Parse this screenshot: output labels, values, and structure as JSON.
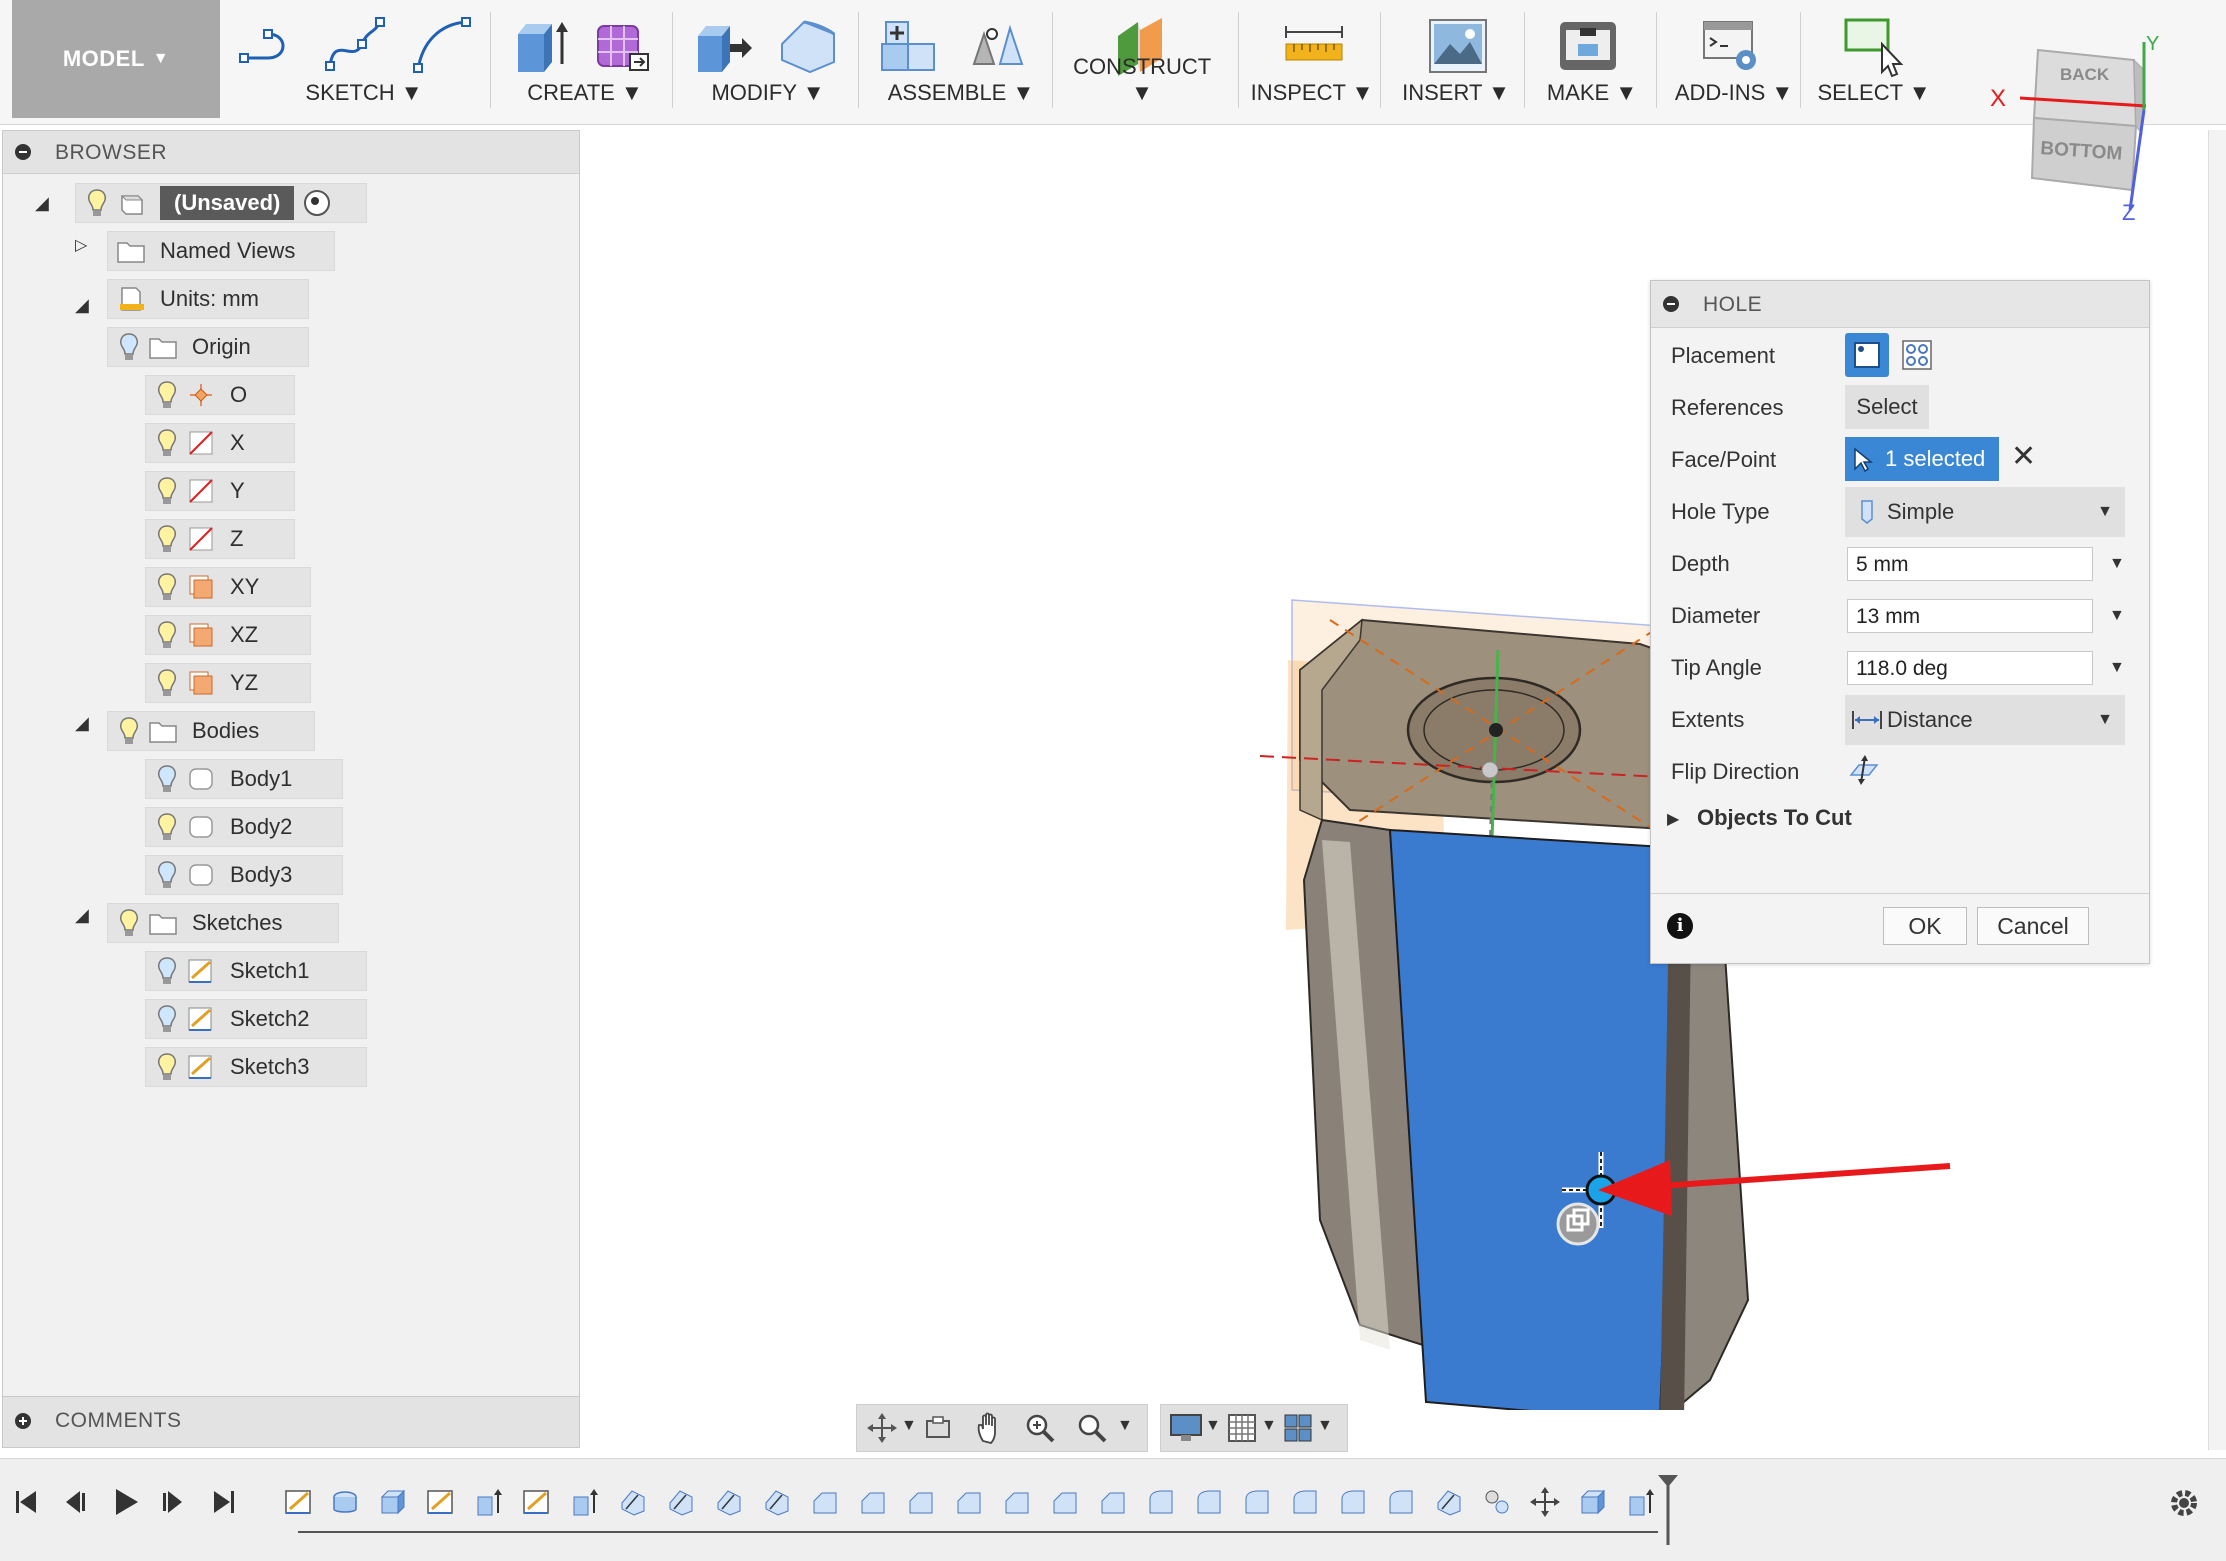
{
  "toolbar": {
    "workspace_label": "MODEL",
    "groups": [
      {
        "label": "SKETCH"
      },
      {
        "label": "CREATE"
      },
      {
        "label": "MODIFY"
      },
      {
        "label": "ASSEMBLE"
      },
      {
        "label": "CONSTRUCT"
      },
      {
        "label": "INSPECT"
      },
      {
        "label": "INSERT"
      },
      {
        "label": "MAKE"
      },
      {
        "label": "ADD-INS"
      },
      {
        "label": "SELECT"
      }
    ]
  },
  "viewcube": {
    "faces": {
      "back": "BACK",
      "bottom": "BOTTOM"
    },
    "axes": {
      "x": "X",
      "y": "Y",
      "z": "Z"
    }
  },
  "browser": {
    "title": "BROWSER",
    "root": "(Unsaved)",
    "items": [
      {
        "label": "Named Views"
      },
      {
        "label": "Units: mm"
      },
      {
        "label": "Origin"
      },
      {
        "label": "O"
      },
      {
        "label": "X"
      },
      {
        "label": "Y"
      },
      {
        "label": "Z"
      },
      {
        "label": "XY"
      },
      {
        "label": "XZ"
      },
      {
        "label": "YZ"
      },
      {
        "label": "Bodies"
      },
      {
        "label": "Body1"
      },
      {
        "label": "Body2"
      },
      {
        "label": "Body3"
      },
      {
        "label": "Sketches"
      },
      {
        "label": "Sketch1"
      },
      {
        "label": "Sketch2"
      },
      {
        "label": "Sketch3"
      }
    ]
  },
  "comments": {
    "title": "COMMENTS"
  },
  "hole_dialog": {
    "title": "HOLE",
    "placement_label": "Placement",
    "references_label": "References",
    "references_button": "Select",
    "face_point_label": "Face/Point",
    "face_point_value": "1 selected",
    "hole_type_label": "Hole Type",
    "hole_type_value": "Simple",
    "depth_label": "Depth",
    "depth_value": "5 mm",
    "diameter_label": "Diameter",
    "diameter_value": "13 mm",
    "tip_angle_label": "Tip Angle",
    "tip_angle_value": "118.0 deg",
    "extents_label": "Extents",
    "extents_value": "Distance",
    "flip_direction_label": "Flip Direction",
    "objects_to_cut_label": "Objects To Cut",
    "ok_label": "OK",
    "cancel_label": "Cancel"
  },
  "colors": {
    "selected_face": "#3a7bd0",
    "accent": "#3a87d6",
    "arrow": "#e8191b"
  }
}
